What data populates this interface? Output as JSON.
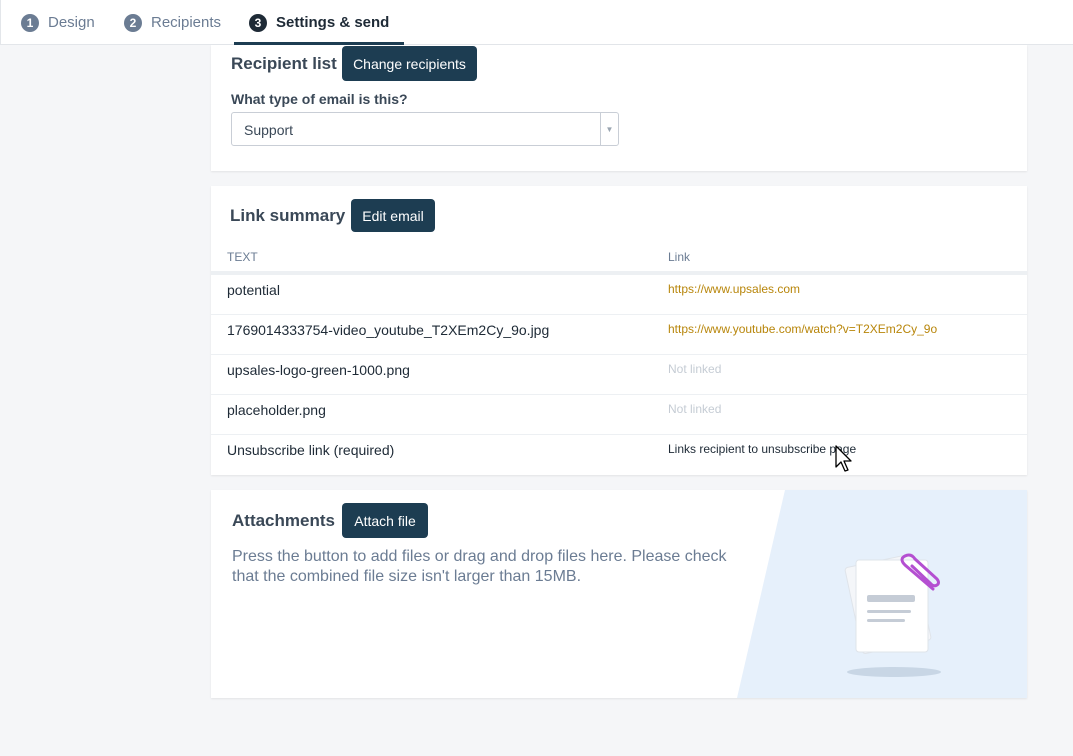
{
  "steps": [
    {
      "num": "1",
      "label": "Design"
    },
    {
      "num": "2",
      "label": "Recipients"
    },
    {
      "num": "3",
      "label": "Settings & send"
    }
  ],
  "recipient_list": {
    "title": "Recipient list",
    "change_button": "Change recipients",
    "email_type_label": "What type of email is this?",
    "email_type_value": "Support"
  },
  "link_summary": {
    "title": "Link summary",
    "edit_button": "Edit email",
    "col_text": "TEXT",
    "col_link": "Link",
    "rows": [
      {
        "text": "potential",
        "link": "https://www.upsales.com"
      },
      {
        "text": "1769014333754-video_youtube_T2XEm2Cy_9o.jpg",
        "link": "https://www.youtube.com/watch?v=T2XEm2Cy_9o"
      },
      {
        "text": "upsales-logo-green-1000.png",
        "link": "Not linked"
      },
      {
        "text": "placeholder.png",
        "link": "Not linked"
      },
      {
        "text": "Unsubscribe link (required)",
        "link": "Links recipient to unsubscribe page"
      }
    ]
  },
  "attachments": {
    "title": "Attachments",
    "attach_button": "Attach file",
    "description": "Press the button to add files or drag and drop files here. Please check that the combined file size isn't larger than 15MB."
  },
  "colors": {
    "primary": "#1d3d52",
    "link": "#b8860b",
    "paperclip": "#b44fd1",
    "illustration_bg": "#e6f0fb"
  }
}
